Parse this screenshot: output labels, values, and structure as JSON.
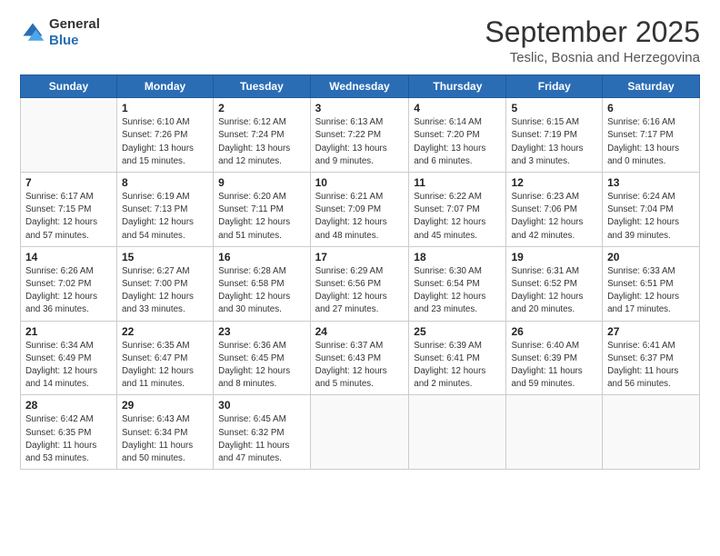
{
  "header": {
    "logo_line1": "General",
    "logo_line2": "Blue",
    "month": "September 2025",
    "location": "Teslic, Bosnia and Herzegovina"
  },
  "days_of_week": [
    "Sunday",
    "Monday",
    "Tuesday",
    "Wednesday",
    "Thursday",
    "Friday",
    "Saturday"
  ],
  "weeks": [
    [
      {
        "day": "",
        "info": ""
      },
      {
        "day": "1",
        "info": "Sunrise: 6:10 AM\nSunset: 7:26 PM\nDaylight: 13 hours\nand 15 minutes."
      },
      {
        "day": "2",
        "info": "Sunrise: 6:12 AM\nSunset: 7:24 PM\nDaylight: 13 hours\nand 12 minutes."
      },
      {
        "day": "3",
        "info": "Sunrise: 6:13 AM\nSunset: 7:22 PM\nDaylight: 13 hours\nand 9 minutes."
      },
      {
        "day": "4",
        "info": "Sunrise: 6:14 AM\nSunset: 7:20 PM\nDaylight: 13 hours\nand 6 minutes."
      },
      {
        "day": "5",
        "info": "Sunrise: 6:15 AM\nSunset: 7:19 PM\nDaylight: 13 hours\nand 3 minutes."
      },
      {
        "day": "6",
        "info": "Sunrise: 6:16 AM\nSunset: 7:17 PM\nDaylight: 13 hours\nand 0 minutes."
      }
    ],
    [
      {
        "day": "7",
        "info": "Sunrise: 6:17 AM\nSunset: 7:15 PM\nDaylight: 12 hours\nand 57 minutes."
      },
      {
        "day": "8",
        "info": "Sunrise: 6:19 AM\nSunset: 7:13 PM\nDaylight: 12 hours\nand 54 minutes."
      },
      {
        "day": "9",
        "info": "Sunrise: 6:20 AM\nSunset: 7:11 PM\nDaylight: 12 hours\nand 51 minutes."
      },
      {
        "day": "10",
        "info": "Sunrise: 6:21 AM\nSunset: 7:09 PM\nDaylight: 12 hours\nand 48 minutes."
      },
      {
        "day": "11",
        "info": "Sunrise: 6:22 AM\nSunset: 7:07 PM\nDaylight: 12 hours\nand 45 minutes."
      },
      {
        "day": "12",
        "info": "Sunrise: 6:23 AM\nSunset: 7:06 PM\nDaylight: 12 hours\nand 42 minutes."
      },
      {
        "day": "13",
        "info": "Sunrise: 6:24 AM\nSunset: 7:04 PM\nDaylight: 12 hours\nand 39 minutes."
      }
    ],
    [
      {
        "day": "14",
        "info": "Sunrise: 6:26 AM\nSunset: 7:02 PM\nDaylight: 12 hours\nand 36 minutes."
      },
      {
        "day": "15",
        "info": "Sunrise: 6:27 AM\nSunset: 7:00 PM\nDaylight: 12 hours\nand 33 minutes."
      },
      {
        "day": "16",
        "info": "Sunrise: 6:28 AM\nSunset: 6:58 PM\nDaylight: 12 hours\nand 30 minutes."
      },
      {
        "day": "17",
        "info": "Sunrise: 6:29 AM\nSunset: 6:56 PM\nDaylight: 12 hours\nand 27 minutes."
      },
      {
        "day": "18",
        "info": "Sunrise: 6:30 AM\nSunset: 6:54 PM\nDaylight: 12 hours\nand 23 minutes."
      },
      {
        "day": "19",
        "info": "Sunrise: 6:31 AM\nSunset: 6:52 PM\nDaylight: 12 hours\nand 20 minutes."
      },
      {
        "day": "20",
        "info": "Sunrise: 6:33 AM\nSunset: 6:51 PM\nDaylight: 12 hours\nand 17 minutes."
      }
    ],
    [
      {
        "day": "21",
        "info": "Sunrise: 6:34 AM\nSunset: 6:49 PM\nDaylight: 12 hours\nand 14 minutes."
      },
      {
        "day": "22",
        "info": "Sunrise: 6:35 AM\nSunset: 6:47 PM\nDaylight: 12 hours\nand 11 minutes."
      },
      {
        "day": "23",
        "info": "Sunrise: 6:36 AM\nSunset: 6:45 PM\nDaylight: 12 hours\nand 8 minutes."
      },
      {
        "day": "24",
        "info": "Sunrise: 6:37 AM\nSunset: 6:43 PM\nDaylight: 12 hours\nand 5 minutes."
      },
      {
        "day": "25",
        "info": "Sunrise: 6:39 AM\nSunset: 6:41 PM\nDaylight: 12 hours\nand 2 minutes."
      },
      {
        "day": "26",
        "info": "Sunrise: 6:40 AM\nSunset: 6:39 PM\nDaylight: 11 hours\nand 59 minutes."
      },
      {
        "day": "27",
        "info": "Sunrise: 6:41 AM\nSunset: 6:37 PM\nDaylight: 11 hours\nand 56 minutes."
      }
    ],
    [
      {
        "day": "28",
        "info": "Sunrise: 6:42 AM\nSunset: 6:35 PM\nDaylight: 11 hours\nand 53 minutes."
      },
      {
        "day": "29",
        "info": "Sunrise: 6:43 AM\nSunset: 6:34 PM\nDaylight: 11 hours\nand 50 minutes."
      },
      {
        "day": "30",
        "info": "Sunrise: 6:45 AM\nSunset: 6:32 PM\nDaylight: 11 hours\nand 47 minutes."
      },
      {
        "day": "",
        "info": ""
      },
      {
        "day": "",
        "info": ""
      },
      {
        "day": "",
        "info": ""
      },
      {
        "day": "",
        "info": ""
      }
    ]
  ]
}
